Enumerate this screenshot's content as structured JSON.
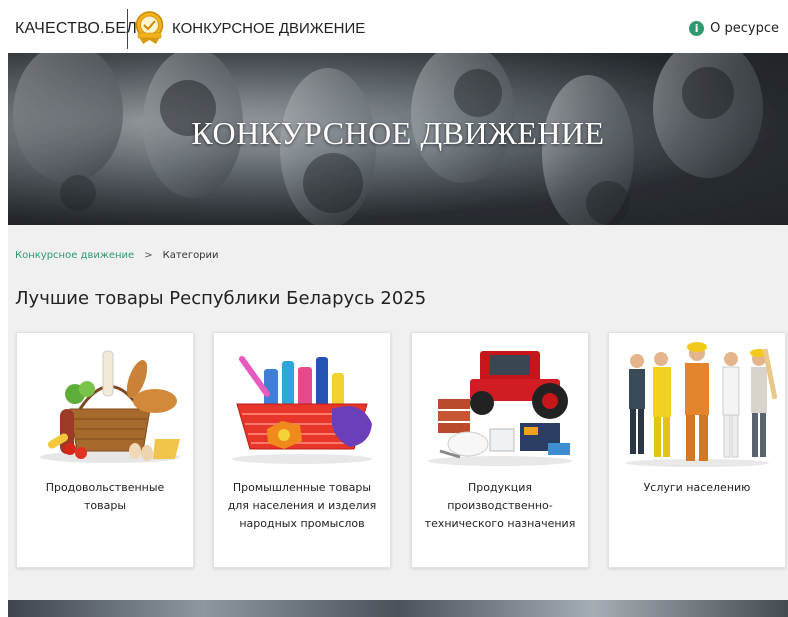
{
  "header": {
    "brand": "КАЧЕСТВО.БЕЛ",
    "section": "КОНКУРСНОЕ ДВИЖЕНИЕ",
    "about_label": "О ресурсе",
    "about_icon_glyph": "i"
  },
  "hero": {
    "title": "КОНКУРСНОЕ ДВИЖЕНИЕ"
  },
  "breadcrumb": {
    "root": "Конкурсное движение",
    "separator": ">",
    "current": "Категории"
  },
  "page_title": "Лучшие товары Республики Беларусь 2025",
  "categories": [
    {
      "label": "Продовольственные товары",
      "icon": "food-basket-image"
    },
    {
      "label": "Промышленные товары для населения и изделия народных промыслов",
      "icon": "household-goods-image"
    },
    {
      "label": "Продукция производственно-технического назначения",
      "icon": "industrial-products-image"
    },
    {
      "label": "Услуги населению",
      "icon": "service-workers-image"
    }
  ],
  "colors": {
    "accent": "#2e9a6e",
    "content_bg": "#f0f0f0"
  }
}
